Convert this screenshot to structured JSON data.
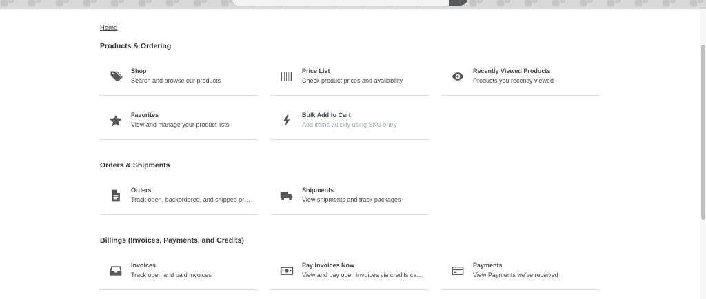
{
  "breadcrumb": {
    "home": "Home"
  },
  "sections": [
    {
      "title": "Products & Ordering",
      "cards": [
        {
          "title": "Shop",
          "desc": "Search and browse our products",
          "icon": "tag-icon"
        },
        {
          "title": "Price List",
          "desc": "Check product prices and availability",
          "icon": "barcode-icon"
        },
        {
          "title": "Recently Viewed Products",
          "desc": "Products you recently viewed",
          "icon": "eye-icon"
        },
        {
          "title": "Favorites",
          "desc": "View and manage your product lists",
          "icon": "star-icon"
        },
        {
          "title": "Bulk Add to Cart",
          "desc": "Add items quickly using SKU entry",
          "icon": "lightning-icon"
        }
      ]
    },
    {
      "title": "Orders & Shipments",
      "cards": [
        {
          "title": "Orders",
          "desc": "Track open, backordered, and shipped orders",
          "icon": "document-icon"
        },
        {
          "title": "Shipments",
          "desc": "View shipments and track packages",
          "icon": "truck-icon"
        }
      ]
    },
    {
      "title": "Billings (Invoices, Payments, and Credits)",
      "cards": [
        {
          "title": "Invoices",
          "desc": "Track open and paid invoices",
          "icon": "inbox-icon"
        },
        {
          "title": "Pay Invoices Now",
          "desc": "View and pay open invoices via credits card ...",
          "icon": "money-bill-icon"
        },
        {
          "title": "Payments",
          "desc": "View Payments we've received",
          "icon": "credit-card-icon"
        }
      ]
    }
  ],
  "colors": {
    "icon": "#555555",
    "muted_text": "#9aaabb",
    "divider": "#dcdcdc"
  }
}
